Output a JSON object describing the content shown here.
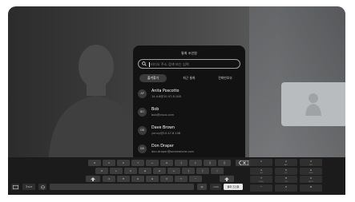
{
  "modal": {
    "title": "통화 조인원",
    "search_placeholder": "비디오 주소 검색 또는 입력",
    "tabs": [
      {
        "label": "즐겨찾기",
        "active": true
      },
      {
        "label": "최근 통화",
        "active": false
      },
      {
        "label": "전화번호부",
        "active": false
      }
    ],
    "contacts": [
      {
        "initials": "AP",
        "name": "Anita Poscotto",
        "address": "14.4.8@10.47.8.108"
      },
      {
        "initials": "BO",
        "name": "Bob",
        "address": "bob@cisco.com"
      },
      {
        "initials": "DB",
        "name": "Dave Brown",
        "address": "yenny@10.47.8.108"
      },
      {
        "initials": "DD",
        "name": "Don Draper",
        "address": "don.draper@somewhere.com"
      }
    ]
  },
  "keyboard": {
    "row1": [
      "ㅂ",
      "ㅈ",
      "ㄷ",
      "ㄱ",
      "ㅅ",
      "ㅛ",
      "ㅕ",
      "ㅑ",
      "ㅐ",
      "ㅔ"
    ],
    "row2": [
      "ㅁ",
      "ㄴ",
      "ㅇ",
      "ㄹ",
      "ㅎ",
      "ㅗ",
      "ㅓ",
      "ㅏ",
      "ㅣ"
    ],
    "row3": [
      "ㅋ",
      "ㅌ",
      "ㅊ",
      "ㅍ",
      "ㅠ",
      "ㅜ",
      "ㅡ"
    ],
    "lang_label": "가123",
    "at_label": "@",
    "com_label": ".com",
    "call_label": "통화 조인원",
    "backspace_icon": "backspace-icon",
    "numpad": [
      {
        "digit": "1",
        "letters": ""
      },
      {
        "digit": "2",
        "letters": "ABC"
      },
      {
        "digit": "3",
        "letters": "DEF"
      },
      {
        "digit": "4",
        "letters": "GHI"
      },
      {
        "digit": "5",
        "letters": "JKL"
      },
      {
        "digit": "6",
        "letters": "MNO"
      },
      {
        "digit": "7",
        "letters": "PQRS"
      },
      {
        "digit": "8",
        "letters": "TUV"
      },
      {
        "digit": "9",
        "letters": "WXYZ"
      },
      {
        "digit": "*",
        "letters": ""
      },
      {
        "digit": "0",
        "letters": "+"
      },
      {
        "digit": "#",
        "letters": ""
      }
    ]
  },
  "colors": {
    "modal_bg": "#121212",
    "call_key": "#e7e7e7"
  }
}
